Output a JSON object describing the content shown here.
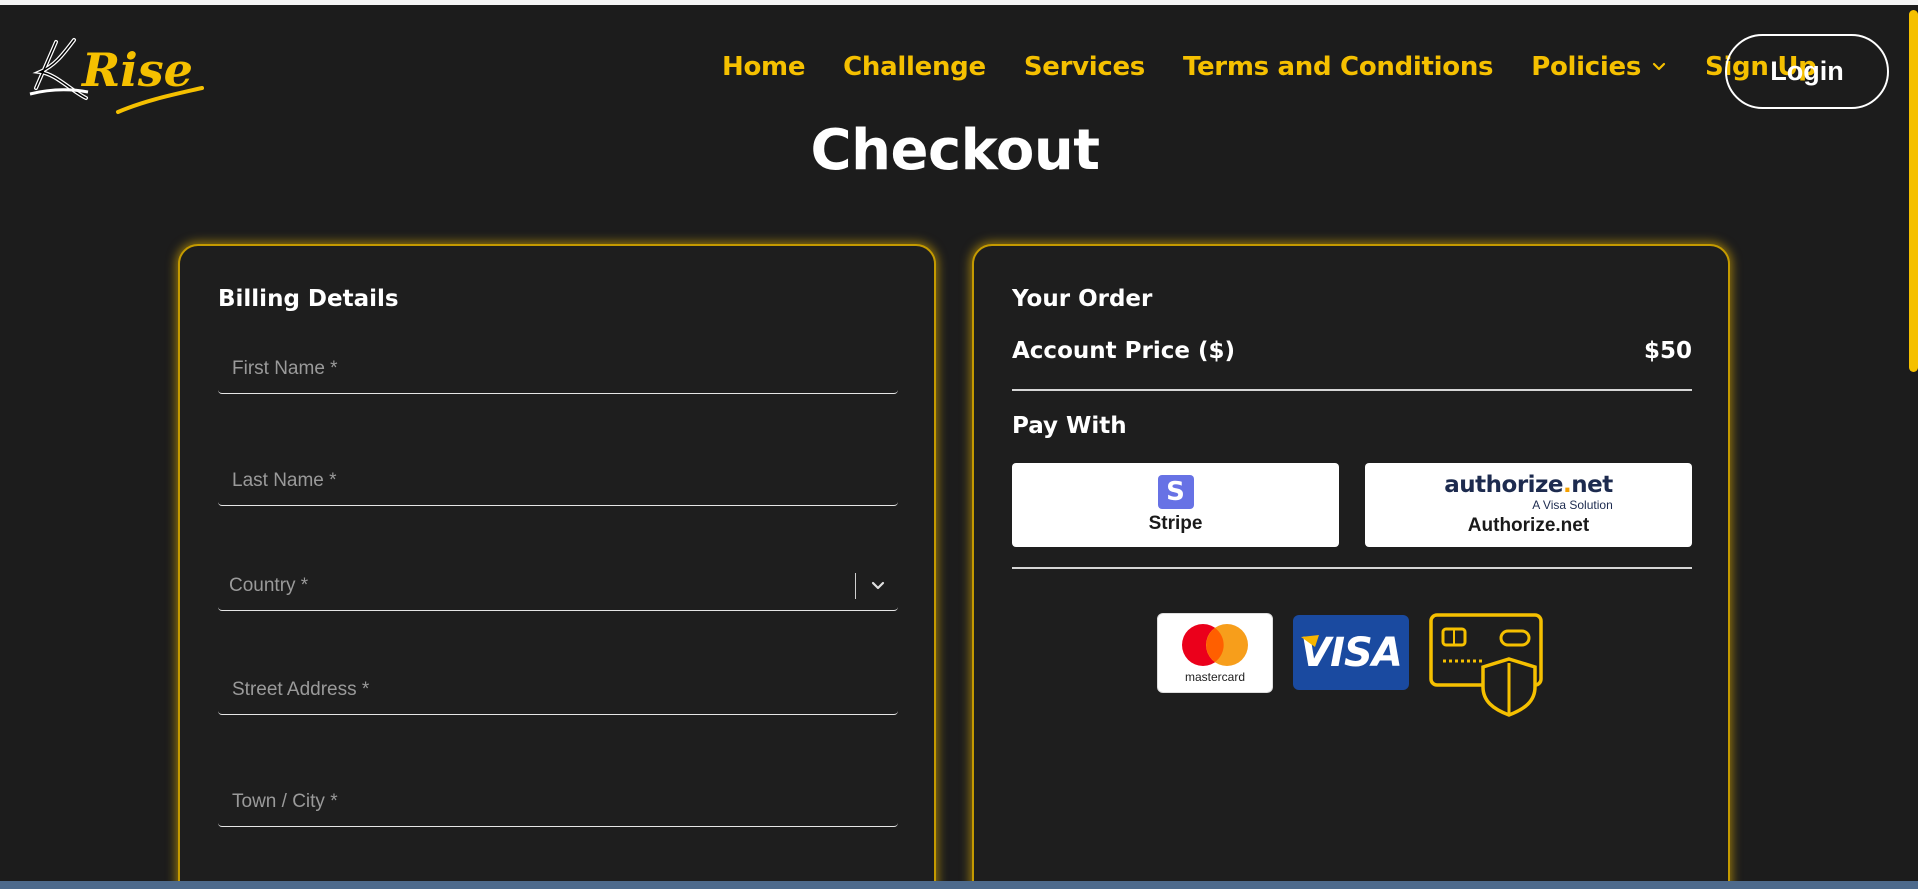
{
  "brand": {
    "logo_text": "KRise",
    "colors": {
      "accent": "#f5c000",
      "background": "#1c1c1c"
    }
  },
  "nav": {
    "items": [
      {
        "label": "Home"
      },
      {
        "label": "Challenge"
      },
      {
        "label": "Services"
      },
      {
        "label": "Terms and Conditions"
      },
      {
        "label": "Policies",
        "icon": "chevron-down-icon"
      },
      {
        "label": "Sign Up"
      }
    ],
    "login_label": "Login"
  },
  "page": {
    "title": "Checkout"
  },
  "billing": {
    "heading": "Billing Details",
    "fields": {
      "first_name": {
        "placeholder": "First Name *",
        "value": ""
      },
      "last_name": {
        "placeholder": "Last Name *",
        "value": ""
      },
      "country": {
        "placeholder": "Country *",
        "value": ""
      },
      "street": {
        "placeholder": "Street Address *",
        "value": ""
      },
      "city": {
        "placeholder": "Town / City *",
        "value": ""
      }
    }
  },
  "order": {
    "heading": "Your Order",
    "price_label": "Account Price ($)",
    "price_value": "$50",
    "pay_with_label": "Pay With",
    "methods": {
      "stripe": {
        "label": "Stripe",
        "icon_letter": "S",
        "icon": "stripe-icon"
      },
      "authorize": {
        "label": "Authorize.net",
        "logo_word": "authorize",
        "logo_dot": ".",
        "logo_tld": "net",
        "logo_sub": "A Visa Solution",
        "icon": "authorize-net-logo"
      }
    },
    "card_badges": {
      "mastercard": "mastercard",
      "visa": "VISA",
      "secure_icon": "secure-card-shield-icon"
    }
  }
}
